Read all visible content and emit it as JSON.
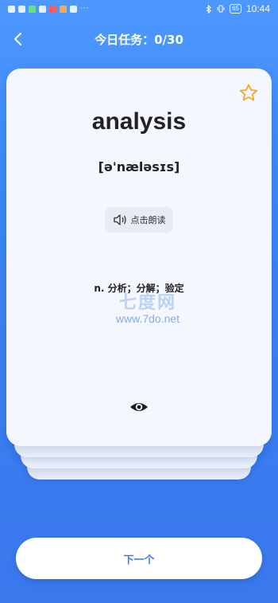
{
  "status_bar": {
    "time": "10:44",
    "battery": "65",
    "more": "···"
  },
  "header": {
    "title": "今日任务：0/30"
  },
  "card": {
    "word": "analysis",
    "phonetic": "[ə'næləsɪs]",
    "read_label": "点击朗读",
    "definition": "n. 分析；分解；验定"
  },
  "watermark": {
    "text": "七度网",
    "url": "www.7do.net"
  },
  "footer": {
    "next_label": "下一个"
  },
  "colors": {
    "accent": "#3a7ff2",
    "star": "#f5a623",
    "card": "#f4f7fd"
  },
  "icons": {
    "back": "chevron-left-icon",
    "star": "star-outline-icon",
    "speaker": "speaker-icon",
    "eye": "eye-icon"
  }
}
